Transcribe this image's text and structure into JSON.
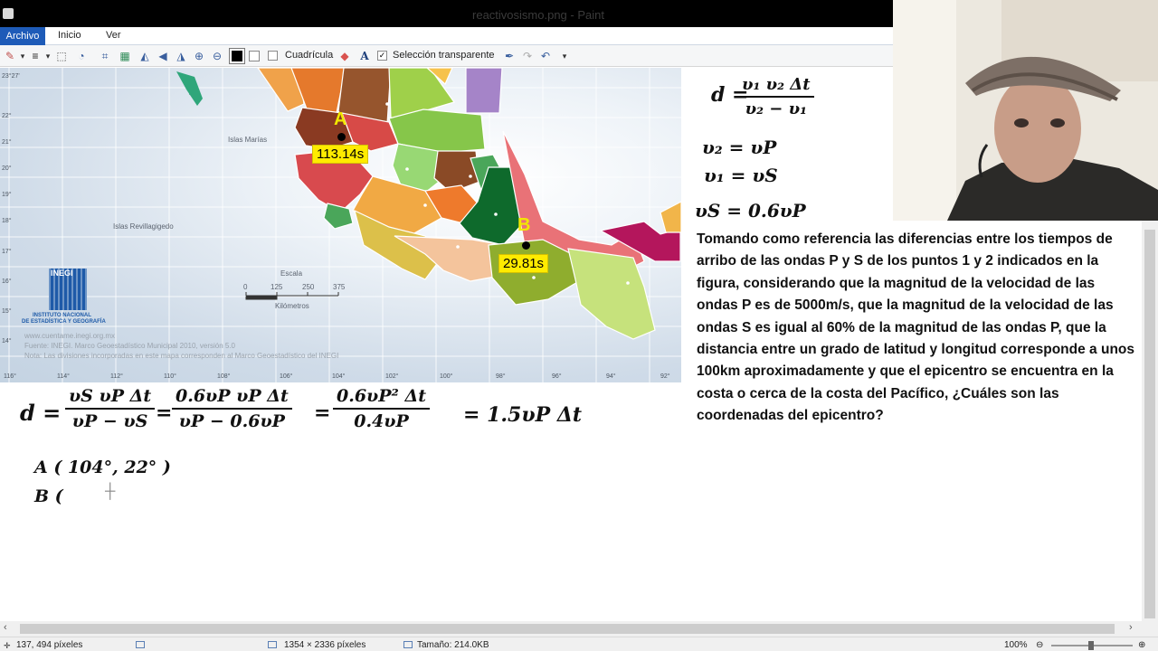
{
  "window": {
    "title": "reactivosismo.png - Paint"
  },
  "ribbon": {
    "tabs": [
      "Archivo",
      "Inicio",
      "Ver"
    ]
  },
  "toolbar": {
    "gridlines_label": "Cuadrícula",
    "gridlines_checked": false,
    "transparent_label": "Selección transparente",
    "transparent_checked": true
  },
  "map": {
    "point_a": {
      "letter": "A",
      "time": "113.14s"
    },
    "point_b": {
      "letter": "B",
      "time": "29.81s"
    },
    "places": {
      "islas_marias": "Islas Marías",
      "revillagigedo": "Islas Revillagigedo"
    },
    "scale": {
      "title": "Escala",
      "ticks": [
        "0",
        "125",
        "250",
        "375"
      ],
      "unit": "Kilómetros"
    },
    "latitudes": [
      "23°27'",
      "22°",
      "21°",
      "20°",
      "19°",
      "18°",
      "17°",
      "16°",
      "15°",
      "14°"
    ],
    "longitudes": [
      "116°",
      "114°",
      "112°",
      "110°",
      "108°",
      "106°",
      "104°",
      "102°",
      "100°",
      "98°",
      "96°",
      "94°",
      "92°"
    ],
    "logo": {
      "name": "INEGI",
      "line1": "INSTITUTO NACIONAL",
      "line2": "DE ESTADÍSTICA Y GEOGRAFÍA"
    },
    "credits": [
      "www.cuentame.inegi.org.mx",
      "Fuente: INEGI. Marco Geoestadístico Municipal 2010, versión 5.0",
      "Nota: Las divisiones incorporadas en este mapa corresponden al Marco Geoestadístico del INEGI"
    ]
  },
  "formulas": {
    "d_lhs": "d =",
    "d_num": "υ₁ υ₂ Δt",
    "d_den": "υ₂ − υ₁",
    "v2": "υ₂ = υP",
    "v1": "υ₁ = υS",
    "vs": "υS = 0.6υP",
    "main_d": "d =",
    "f1_num": "υS υP Δt",
    "f1_den": "υP − υS",
    "eq1": "=",
    "f2_num": "0.6υP υP Δt",
    "f2_den": "υP − 0.6υP",
    "eq2": "=",
    "f3_num": "0.6υP² Δt",
    "f3_den": "0.4υP",
    "result": "= 1.5υP Δt",
    "coord_a": "A ( 104°, 22° )",
    "coord_b": "B ("
  },
  "problem": {
    "text": "Tomando como referencia las diferencias entre los tiempos de arribo de las ondas P y S de los puntos 1 y 2 indicados en la figura, considerando que la magnitud de la velocidad de las ondas P es de 5000m/s, que la magnitud de la velocidad de las ondas S es igual al 60% de la magnitud de las ondas P, que la distancia entre un grado de latitud y longitud corresponde a unos 100km aproximadamente y que el epicentro se encuentra en la costa o cerca de la costa del Pacífico, ¿Cuáles son las coordenadas del epicentro?"
  },
  "status": {
    "cursor": "137, 494 píxeles",
    "dimensions": "1354 × 2336 píxeles",
    "size": "Tamaño: 214.0KB",
    "zoom": "100%"
  }
}
